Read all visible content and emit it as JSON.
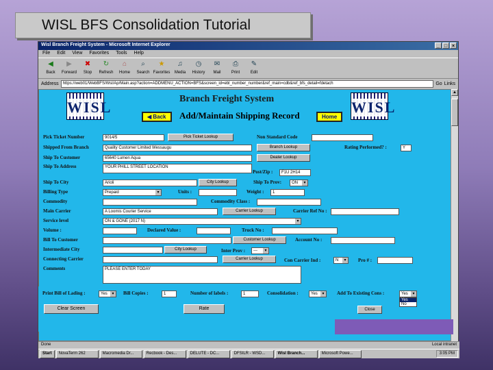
{
  "slide": {
    "title": "WISL BFS Consolidation Tutorial"
  },
  "window": {
    "title": "Wisl Branch Freight System - Microsoft Internet Explorer"
  },
  "menu": [
    "File",
    "Edit",
    "View",
    "Favorites",
    "Tools",
    "Help"
  ],
  "toolbar": [
    {
      "label": "Back",
      "icon": "back-icon"
    },
    {
      "label": "Forward",
      "icon": "forward-icon"
    },
    {
      "label": "Stop",
      "icon": "stop-icon"
    },
    {
      "label": "Refresh",
      "icon": "refresh-icon"
    },
    {
      "label": "Home",
      "icon": "home-icon"
    },
    {
      "label": "Search",
      "icon": "search-icon"
    },
    {
      "label": "Favorites",
      "icon": "favorites-icon"
    },
    {
      "label": "Media",
      "icon": "media-icon"
    },
    {
      "label": "History",
      "icon": "history-icon"
    },
    {
      "label": "Mail",
      "icon": "mail-icon"
    },
    {
      "label": "Print",
      "icon": "print-icon"
    },
    {
      "label": "Edit",
      "icon": "edit-icon"
    }
  ],
  "address": {
    "label": "Address",
    "url": "https://web01/WebBFS/Wsl/Ap/Main.asp?action=ADDMENU_ACTION=BFS&screen_id=ebl_number_number&ref_main=cdb&ref_bfs_detail=fdetach",
    "go": "Go",
    "links": "Links"
  },
  "page": {
    "logo_text": "WISL",
    "title": "Branch Freight System",
    "subtitle": "Add/Maintain Shipping Record",
    "back": "Back",
    "home": "Home"
  },
  "form": {
    "pick_ticket": {
      "label": "Pick Ticket Number",
      "value": "9014/5",
      "button": "Pick Ticket Lookup"
    },
    "non_standard": {
      "label": "Non Standard Code",
      "value": ""
    },
    "shipped_from": {
      "label": "Shipped From Branch",
      "value": "Quality Customer Limited Wessaugu",
      "button": "Branch Lookup"
    },
    "rating": {
      "label": "Rating Performed? :",
      "value": "Y"
    },
    "ship_to_customer": {
      "label": "Ship To Customer",
      "value": "65640 Lumen Aqua",
      "button": "Dealer Lookup"
    },
    "ship_to_address": {
      "label": "Ship To Address",
      "value": "YOUR PHILL STREET LOCATION"
    },
    "postzip": {
      "label": "Post/Zip :",
      "value": "F1U 2H14"
    },
    "ship_to_city": {
      "label": "Ship To City",
      "value": "Arioli",
      "button": "City Lookup"
    },
    "ship_to_prov": {
      "label": "Ship To Prov:",
      "value": "ON"
    },
    "billing_type": {
      "label": "Billing Type",
      "value": "Prepaid"
    },
    "units": {
      "label": "Units :",
      "value": ""
    },
    "weight": {
      "label": "Weight :",
      "value": "1"
    },
    "commodity": {
      "label": "Commodity",
      "value": ""
    },
    "commodity_class": {
      "label": "Commodity Class :",
      "value": ""
    },
    "main_carrier": {
      "label": "Main Carrier",
      "value": "A Loomis Courier Service",
      "button": "Carrier Lookup"
    },
    "carrier_ref": {
      "label": "Carrier Ref No :",
      "value": ""
    },
    "service_level": {
      "label": "Service level",
      "value": "ON & GONE (2017 N)"
    },
    "volume": {
      "label": "Volume :",
      "value": ""
    },
    "declared_value": {
      "label": "Declared Value :",
      "value": ""
    },
    "truck_no": {
      "label": "Truck No :",
      "value": ""
    },
    "bill_to_customer": {
      "label": "Bill To Customer",
      "value": "",
      "button": "Customer Lookup"
    },
    "account_no": {
      "label": "Account No :",
      "value": ""
    },
    "intermediate_city": {
      "label": "Intermediate City",
      "value": "",
      "button": "City Lookup"
    },
    "inter_prov": {
      "label": "Inter Prov :",
      "value": "---"
    },
    "connecting_carrier": {
      "label": "Connecting Carrier",
      "value": "",
      "button": "Carrier Lookup"
    },
    "con_carrier_ind": {
      "label": "Con Carrier Ind :",
      "value": "N"
    },
    "pro": {
      "label": "Pro # :",
      "value": ""
    },
    "comments": {
      "label": "Comments",
      "value": "PLEASE ENTER TODAY"
    },
    "print_bol": {
      "label": "Print Bill of Lading :",
      "value": "Yes"
    },
    "bill_copies": {
      "label": "Bill Copies :",
      "value": "1"
    },
    "labels": {
      "label": "Number of labels :",
      "value": "1"
    },
    "consolidation": {
      "label": "Consolidation :",
      "value": "Yes"
    },
    "add_existing": {
      "label": "Add To Existing Cons :",
      "value": "Yes",
      "option_yes": "Yes",
      "option_no": "No"
    },
    "clear": "Clear Screen",
    "rate": "Rate",
    "other": "Close"
  },
  "status": {
    "text": "Done",
    "zone": "Local intranet"
  },
  "taskbar": [
    "Start",
    "NovaTerm 262",
    "Macromedia Dr...",
    "Recbook - Des...",
    "DELUTE - DC...",
    "DFSILR - WSD...",
    "Wisl Branch...",
    "Microsoft Powe..."
  ],
  "clock": "3:05 PM"
}
